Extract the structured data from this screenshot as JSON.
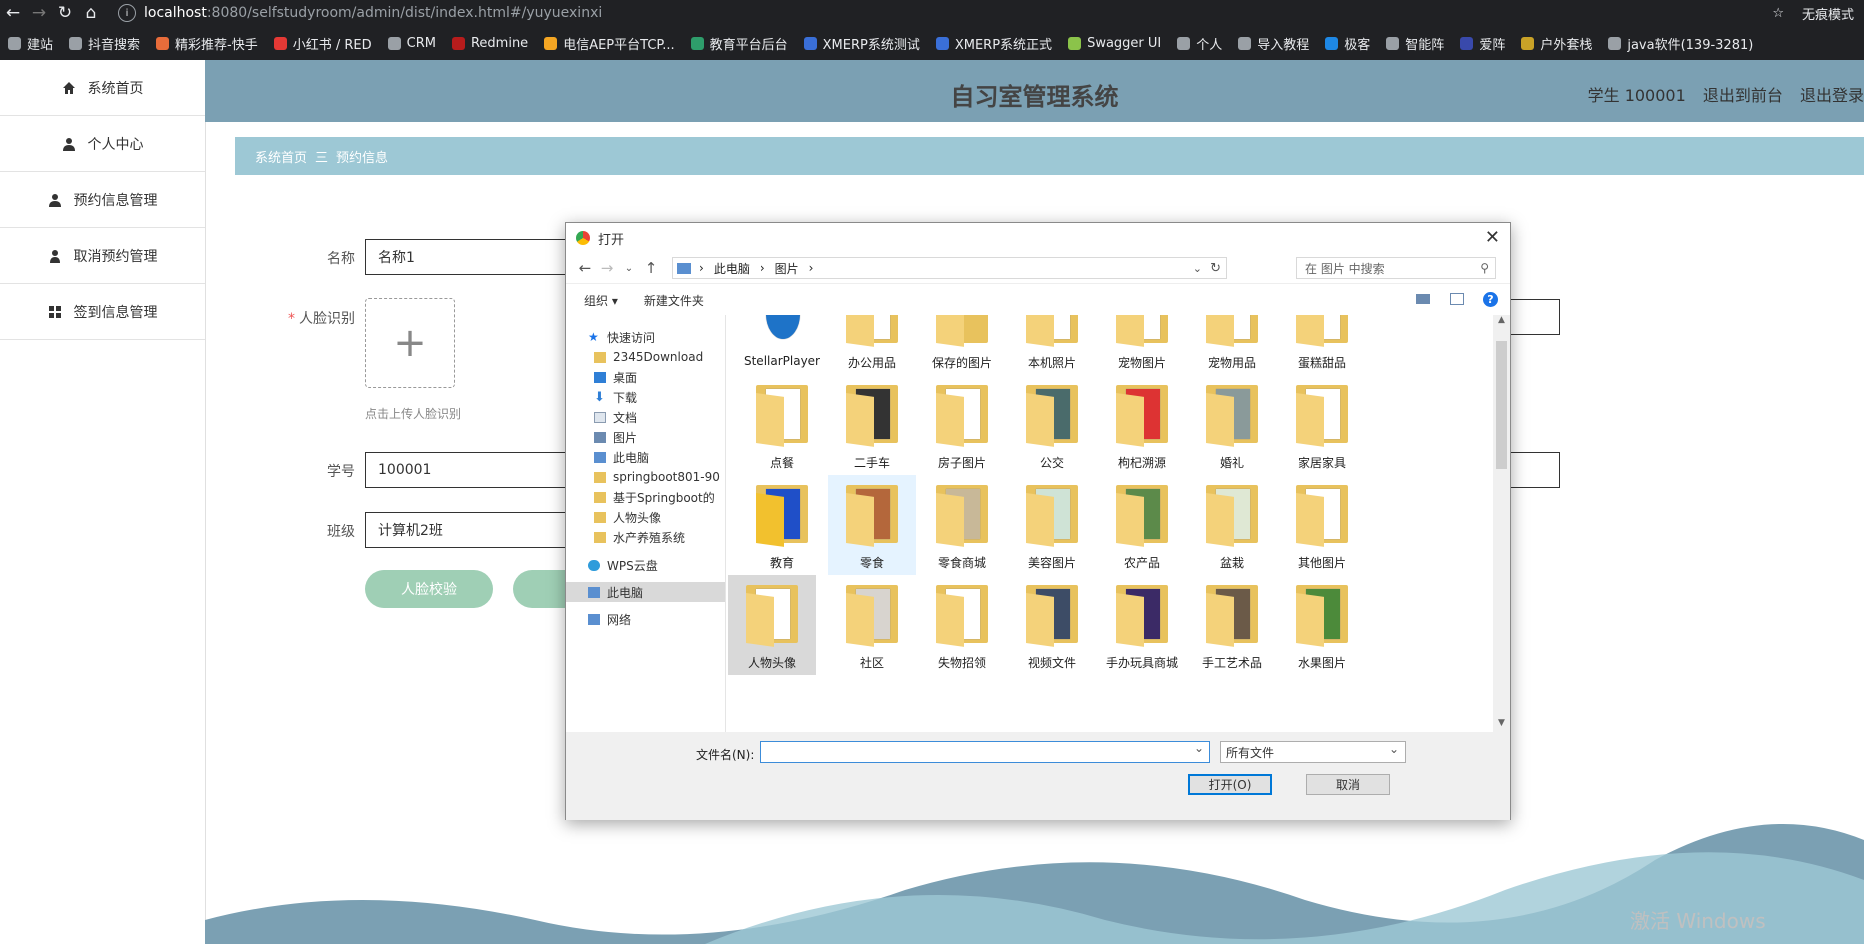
{
  "browser": {
    "url_host": "localhost",
    "url_path": ":8080/selfstudyroom/admin/dist/index.html#/yuyuexinxi",
    "incognito": "无痕模式",
    "bookmarks": [
      "建站",
      "抖音搜索",
      "精彩推荐-快手",
      "小红书 / RED",
      "CRM",
      "Redmine",
      "电信AEP平台TCP...",
      "教育平台后台",
      "XMERP系统测试",
      "XMERP系统正式",
      "Swagger UI",
      "个人",
      "导入教程",
      "极客",
      "智能阵",
      "爱阵",
      "户外套栈",
      "java软件(139-3281)"
    ]
  },
  "app": {
    "title": "自习室管理系统",
    "user": "学生 100001",
    "back_front": "退出到前台",
    "logout": "退出登录",
    "sidebar": [
      "系统首页",
      "个人中心",
      "预约信息管理",
      "取消预约管理",
      "签到信息管理"
    ],
    "breadcrumb": {
      "home": "系统首页",
      "sep": "三",
      "current": "预约信息"
    },
    "form": {
      "name_label": "名称",
      "name_value": "名称1",
      "face_label": "人脸识别",
      "upload_tip": "点击上传人脸识别",
      "id_label": "学号",
      "id_value": "100001",
      "class_label": "班级",
      "class_value": "计算机2班",
      "btn_face_check": "人脸校验"
    },
    "watermark": "激活 Windows"
  },
  "dialog": {
    "title": "打开",
    "path": [
      "此电脑",
      "图片"
    ],
    "search_placeholder": "在 图片 中搜索",
    "organize": "组织",
    "new_folder": "新建文件夹",
    "nav": [
      {
        "label": "快速访问",
        "pinned": false
      },
      {
        "label": "2345Download",
        "pinned": true
      },
      {
        "label": "桌面",
        "pinned": true
      },
      {
        "label": "下载",
        "pinned": true
      },
      {
        "label": "文档",
        "pinned": true
      },
      {
        "label": "图片",
        "pinned": true
      },
      {
        "label": "此电脑",
        "pinned": true
      },
      {
        "label": "springboot801-90",
        "pinned": false
      },
      {
        "label": "基于Springboot的",
        "pinned": false
      },
      {
        "label": "人物头像",
        "pinned": false
      },
      {
        "label": "水产养殖系统",
        "pinned": false
      },
      {
        "label": "WPS云盘",
        "pinned": false
      },
      {
        "label": "此电脑",
        "pinned": false
      },
      {
        "label": "网络",
        "pinned": false
      }
    ],
    "folders": [
      "StellarPlayer",
      "办公用品",
      "保存的图片",
      "本机照片",
      "宠物图片",
      "宠物用品",
      "蛋糕甜品",
      "点餐",
      "二手车",
      "房子图片",
      "公交",
      "枸杞溯源",
      "婚礼",
      "家居家具",
      "教育",
      "零食",
      "零食商城",
      "美容图片",
      "农产品",
      "盆栽",
      "其他图片",
      "人物头像",
      "社区",
      "失物招领",
      "视频文件",
      "手办玩具商城",
      "手工艺术品",
      "水果图片"
    ],
    "filename_label": "文件名(N):",
    "filetype": "所有文件",
    "open_btn": "打开(O)",
    "cancel_btn": "取消"
  }
}
